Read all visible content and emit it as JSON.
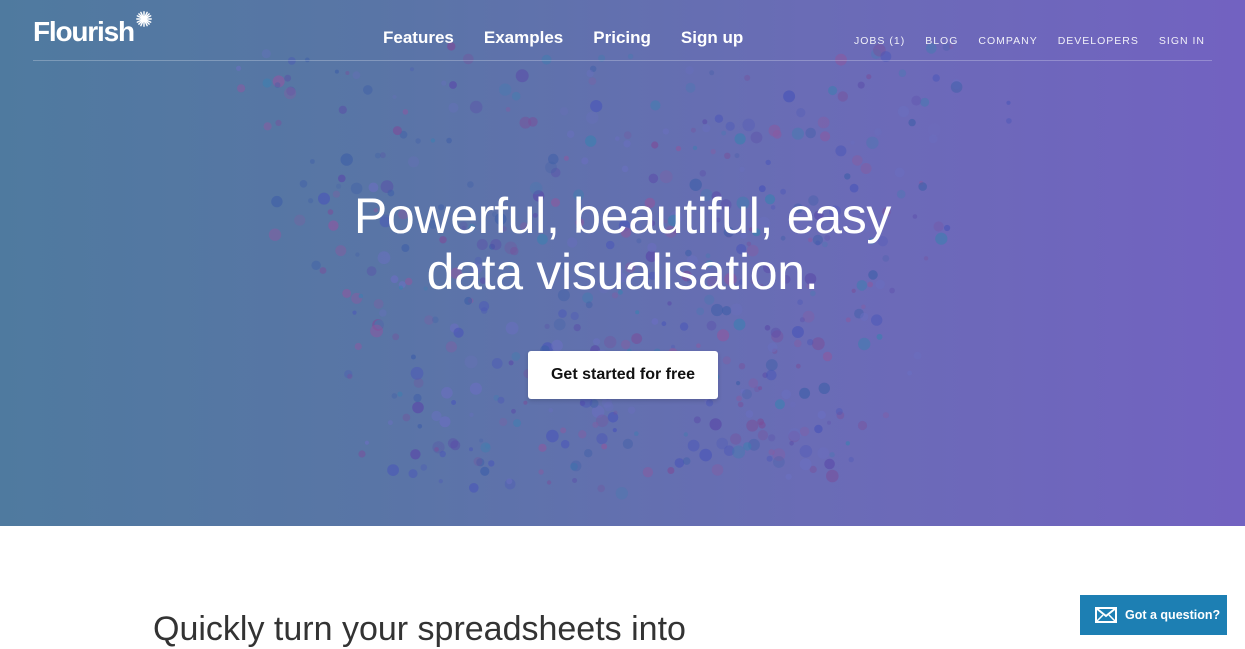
{
  "brand": {
    "name": "Flourish",
    "icon": "sparkle-icon"
  },
  "main_nav": [
    {
      "label": "Features"
    },
    {
      "label": "Examples"
    },
    {
      "label": "Pricing"
    },
    {
      "label": "Sign up"
    }
  ],
  "secondary_nav": [
    {
      "label": "JOBS (1)"
    },
    {
      "label": "BLOG"
    },
    {
      "label": "COMPANY"
    },
    {
      "label": "DEVELOPERS"
    },
    {
      "label": "SIGN IN"
    }
  ],
  "hero": {
    "headline_line1": "Powerful, beautiful, easy",
    "headline_line2": "data visualisation.",
    "cta_label": "Get started for free",
    "background_colors": [
      "#4f7a9f",
      "#7262c1"
    ],
    "particle_colors": [
      "#3f5fa8",
      "#5a4aa8",
      "#7a4f9a",
      "#3d7fb0",
      "#6a6fc0",
      "#8a5aa0",
      "#4a56b8"
    ]
  },
  "section": {
    "title": "Quickly turn your spreadsheets into"
  },
  "chat_widget": {
    "label": "Got a question?",
    "icon": "mail-icon",
    "color": "#1d7fb3"
  }
}
